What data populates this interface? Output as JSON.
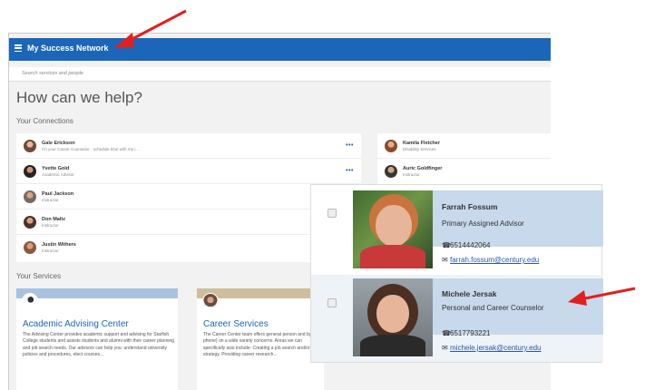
{
  "app": {
    "title": "My Success Network"
  },
  "search": {
    "placeholder": "Search services and people"
  },
  "page": {
    "heading": "How can we help?"
  },
  "connections": {
    "label": "Your Connections",
    "items": [
      {
        "name": "Gale Erickson",
        "role": "I'm your Career Counselor - schedule time with me i..."
      },
      {
        "name": "Yvette Gold",
        "role": "Academic Advisor"
      },
      {
        "name": "Paul Jackson",
        "role": "Instructor"
      },
      {
        "name": "Don Maltz",
        "role": "Instructor"
      },
      {
        "name": "Justin Withers",
        "role": "Instructor"
      }
    ],
    "items_right": [
      {
        "name": "Kamila Fletcher",
        "role": "Disability Services"
      },
      {
        "name": "Auric Goldfinger",
        "role": "Instructor"
      }
    ]
  },
  "services": {
    "label": "Your Services",
    "items": [
      {
        "title": "Academic Advising Center",
        "description": "The Advising Center provides academic support and advising for Starfish College students and assists students and alumni with their career planning and job search needs. Our advisors can help you: understand university policies and procedures, elect courses...",
        "color": "#a9c2e0"
      },
      {
        "title": "Career Services",
        "description": "The Career Center team offers general person and by phone) on a wide variety concerns. Areas we can specifically assi include: Creating a job search and/or ca strategy, Providing career research...",
        "color": "#cdbf9d"
      }
    ]
  },
  "zoomed": {
    "people": [
      {
        "name": "Farrah Fossum",
        "role": "Primary Assigned Advisor",
        "phone": "6514442064",
        "email": "farrah.fossum@century.edu"
      },
      {
        "name": "Michele Jersak",
        "role": "Personal and Career Counselor",
        "phone": "6517793221",
        "email": "michele.jersak@century.edu"
      }
    ]
  },
  "colors": {
    "brand": "#1b66b8",
    "arrow": "#e02020",
    "highlight": "#c7d9ea"
  },
  "icons": {
    "menu": "hamburger-icon",
    "more": "more-dots-icon",
    "phone": "phone-icon",
    "email": "email-icon"
  }
}
